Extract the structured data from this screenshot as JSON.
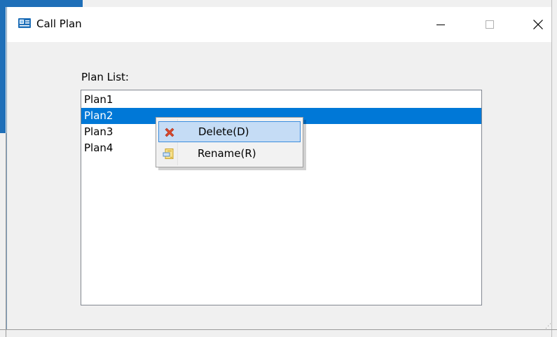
{
  "window": {
    "title": "Call Plan",
    "icon": "app-window-icon",
    "controls": {
      "minimize": "minimize-icon",
      "maximize": "maximize-icon",
      "close": "close-icon"
    }
  },
  "plan_list": {
    "label": "Plan List:",
    "items": [
      {
        "label": "Plan1",
        "selected": false
      },
      {
        "label": "Plan2",
        "selected": true
      },
      {
        "label": "Plan3",
        "selected": false
      },
      {
        "label": "Plan4",
        "selected": false
      }
    ]
  },
  "context_menu": {
    "items": [
      {
        "label": "Delete(D)",
        "icon": "delete-icon",
        "highlighted": true
      },
      {
        "label": "Rename(R)",
        "icon": "rename-icon",
        "highlighted": false
      }
    ]
  },
  "colors": {
    "selection": "#0078d7",
    "menu_hover": "#c5dcf5",
    "menu_hover_border": "#3c8dde",
    "delete_icon": "#d9472b"
  }
}
